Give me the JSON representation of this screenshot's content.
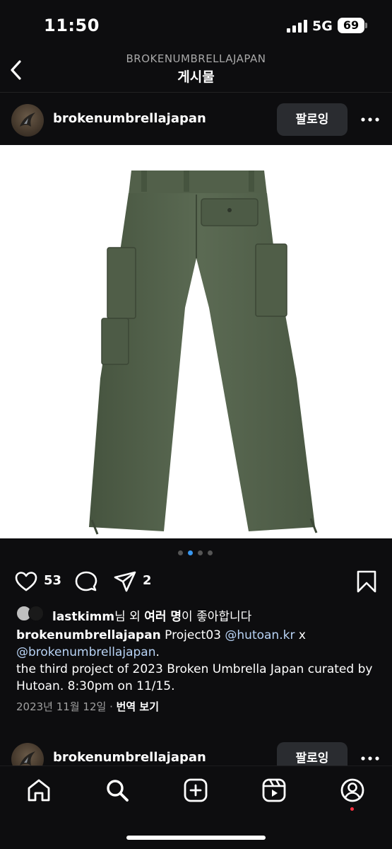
{
  "status_bar": {
    "time": "11:50",
    "network": "5G",
    "battery": "69"
  },
  "header": {
    "subtitle": "BROKENUMBRELLAJAPAN",
    "title": "게시물"
  },
  "post": {
    "username": "brokenumbrellajapan",
    "follow_label": "팔로잉",
    "carousel": {
      "count": 4,
      "active": 1
    },
    "like_count": "53",
    "share_count": "2",
    "liked_by": {
      "user": "lastkimm",
      "suffix_mid": "님 외 ",
      "others": "여러 명",
      "suffix_end": "이 좋아합니다"
    },
    "caption": {
      "username": "brokenumbrellajapan",
      "text1": " Project03 ",
      "mention1": "@hutoan.kr",
      "text2": " x ",
      "mention2": "@brokenumbrellajapan",
      "text3": ".",
      "line2": "the third project of 2023 Broken Umbrella Japan curated by Hutoan. 8:30pm on 11/15."
    },
    "date": "2023년 11월 12일",
    "separator": " · ",
    "translate_label": "번역 보기"
  },
  "next_post": {
    "username": "brokenumbrellajapan",
    "follow_label": "팔로잉"
  },
  "tabbar": {
    "items": [
      "home",
      "search",
      "create",
      "reels",
      "profile"
    ]
  },
  "icons": {
    "back": "chevron-left-icon",
    "more": "more-horizontal-icon",
    "like": "heart-icon",
    "comment": "comment-icon",
    "share": "send-icon",
    "save": "bookmark-icon"
  },
  "colors": {
    "background": "#0d0d0f",
    "follow_button": "#2a2c30",
    "mention": "#b8d3f5",
    "active_dot": "#3897f0",
    "notification": "#ff3040"
  }
}
